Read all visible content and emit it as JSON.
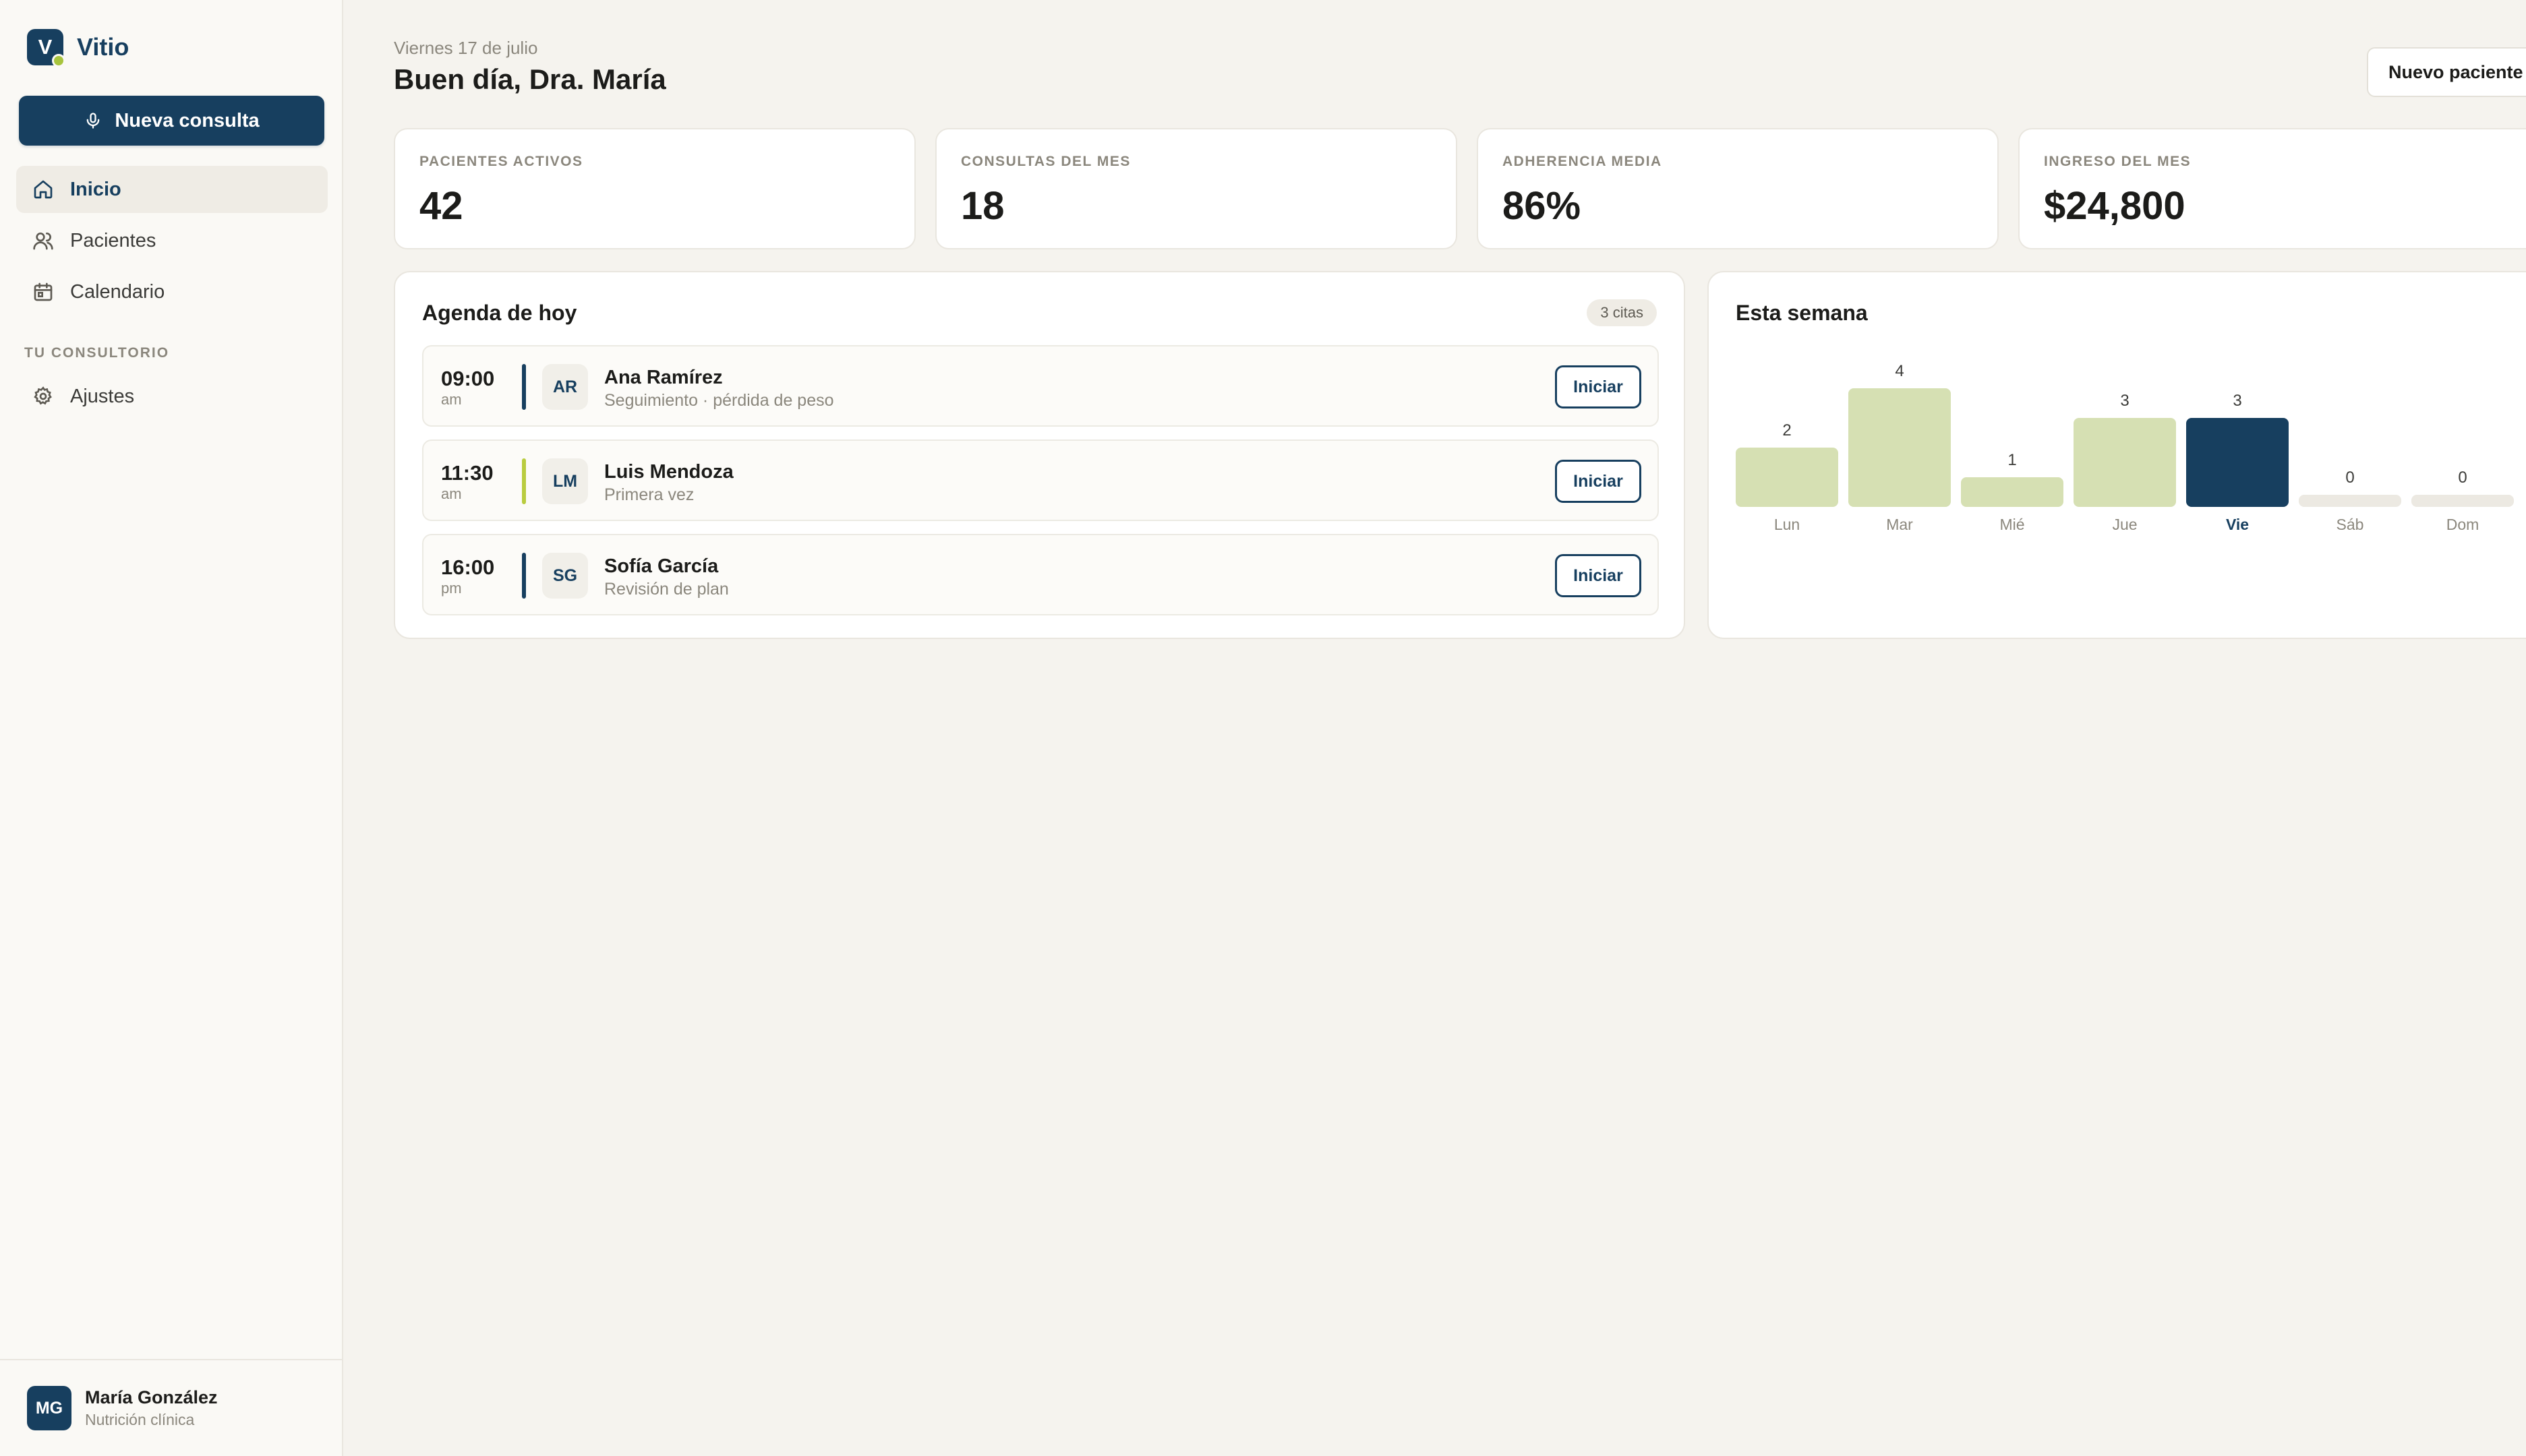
{
  "app": {
    "name": "Vitio",
    "logo_letter": "V"
  },
  "sidebar": {
    "new_consult_label": "Nueva consulta",
    "nav": [
      {
        "label": "Inicio",
        "icon": "home-icon",
        "active": true
      },
      {
        "label": "Pacientes",
        "icon": "users-icon",
        "active": false
      },
      {
        "label": "Calendario",
        "icon": "calendar-icon",
        "active": false
      }
    ],
    "section_label": "TU CONSULTORIO",
    "nav2": [
      {
        "label": "Ajustes",
        "icon": "gear-icon",
        "active": false
      }
    ],
    "user": {
      "initials": "MG",
      "name": "María González",
      "role": "Nutrición clínica"
    }
  },
  "header": {
    "date": "Viernes 17 de julio",
    "greeting": "Buen día, Dra. María",
    "new_patient_label": "Nuevo paciente"
  },
  "stats": [
    {
      "label": "PACIENTES ACTIVOS",
      "value": "42"
    },
    {
      "label": "CONSULTAS DEL MES",
      "value": "18"
    },
    {
      "label": "ADHERENCIA MEDIA",
      "value": "86%"
    },
    {
      "label": "INGRESO DEL MES",
      "value": "$24,800"
    }
  ],
  "agenda": {
    "title": "Agenda de hoy",
    "count_badge": "3 citas",
    "items": [
      {
        "time": "09:00",
        "ampm": "am",
        "initials": "AR",
        "name": "Ana Ramírez",
        "desc": "Seguimiento · pérdida de peso",
        "accent": "#173f5f",
        "action": "Iniciar"
      },
      {
        "time": "11:30",
        "ampm": "am",
        "initials": "LM",
        "name": "Luis Mendoza",
        "desc": "Primera vez",
        "accent": "#b9cc3f",
        "action": "Iniciar"
      },
      {
        "time": "16:00",
        "ampm": "pm",
        "initials": "SG",
        "name": "Sofía García",
        "desc": "Revisión de plan",
        "accent": "#173f5f",
        "action": "Iniciar"
      }
    ]
  },
  "week": {
    "title": "Esta semana"
  },
  "chart_data": {
    "type": "bar",
    "title": "Esta semana",
    "categories": [
      "Lun",
      "Mar",
      "Mié",
      "Jue",
      "Vie",
      "Sáb",
      "Dom"
    ],
    "values": [
      2,
      4,
      1,
      3,
      3,
      0,
      0
    ],
    "highlight_category": "Vie",
    "ylim": [
      0,
      4
    ],
    "grid": false,
    "colors": {
      "bar": "#d6e0b3",
      "highlight": "#173f5f",
      "empty": "#ece9e2"
    }
  }
}
